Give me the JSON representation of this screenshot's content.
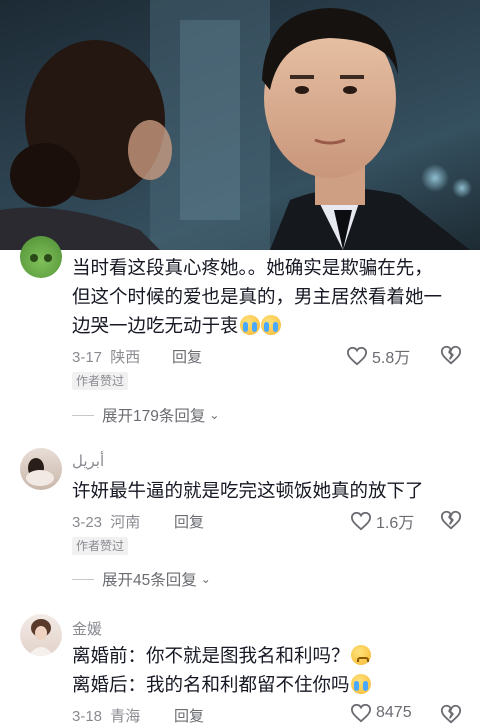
{
  "comments": [
    {
      "username": "",
      "lines": [
        "当时看这段真心疼她。。她确实是欺骗在先，",
        "但这个时候的爱也是真的，男主居然看着她一",
        "边哭一边吃无动于衷"
      ],
      "emoji": [
        "cry",
        "cry"
      ],
      "date": "3-17",
      "location": "陕西",
      "reply_label": "回复",
      "likes": "5.8万",
      "badge": "作者赞过",
      "expand": "展开179条回复"
    },
    {
      "username": "أبريل",
      "lines": [
        "许妍最牛逼的就是吃完这顿饭她真的放下了"
      ],
      "emoji": [],
      "date": "3-23",
      "location": "河南",
      "reply_label": "回复",
      "likes": "1.6万",
      "badge": "作者赞过",
      "expand": "展开45条回复"
    },
    {
      "username": "金媛",
      "lines": [
        "离婚前：你不就是图我名和利吗？",
        "离婚后：我的名和利都留不住你吗"
      ],
      "emoji": [
        "sad",
        "cry"
      ],
      "date": "3-18",
      "location": "青海",
      "reply_label": "回复",
      "likes": "8475"
    }
  ],
  "colors": {
    "text": "#161823",
    "muted": "#8a8b91",
    "like": "#6b6c72",
    "accent": "#fe2c55"
  },
  "icons": {
    "like": "heart-outline-icon",
    "dislike": "broken-heart-icon",
    "expand": "chevron-down-icon"
  }
}
